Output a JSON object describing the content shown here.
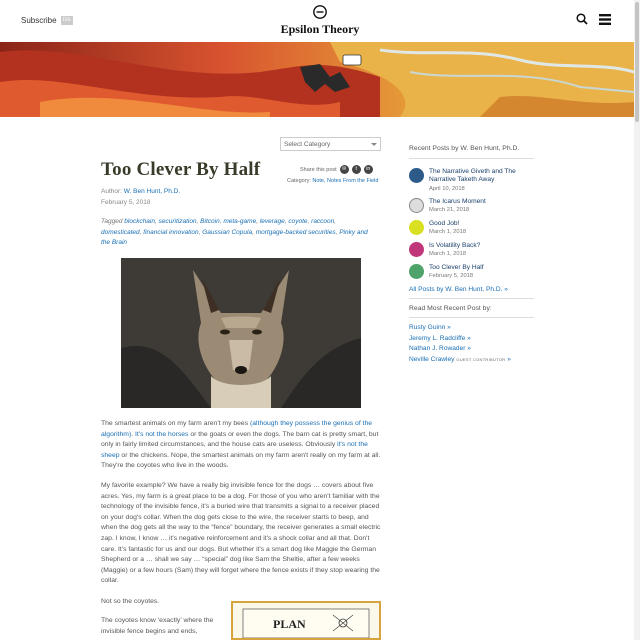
{
  "header": {
    "subscribe_label": "Subscribe",
    "rss_badge": "rss",
    "site_title": "Epsilon Theory",
    "icons": [
      "epsilon-logo-icon",
      "search-icon",
      "hamburger-menu-icon"
    ]
  },
  "category_select": {
    "placeholder": "Select Category"
  },
  "post": {
    "title": "Too Clever By Half",
    "author_prefix": "Author: ",
    "author": "W. Ben Hunt, Ph.D.",
    "date": "February 5, 2018",
    "share_label": "Share this post",
    "category_prefix": "Category: ",
    "category": "Note, Notes From the Field",
    "tagged_prefix": "Tagged ",
    "tags": [
      "blockchain",
      "securitization",
      "Bitcoin",
      "meta-game",
      "leverage",
      "coyote",
      "raccoon",
      "domesticated",
      "financial innovation",
      "Gaussian Copula",
      "mortgage-backed securities",
      "Pinky and the Brain"
    ],
    "p1_a": "The smartest animals on my farm aren't my bees ",
    "p1_link1": "(although they possess the genius of the algorithm)",
    "p1_b": ". ",
    "p1_link2": "It's not the horses",
    "p1_c": " or the goats or even the dogs. The barn cat is pretty smart, but only in fairly limited circumstances, and the house cats are useless. Obviously ",
    "p1_link3": "it's not the sheep",
    "p1_d": " or the chickens. Nope, the smartest animals on my farm aren't really on my farm at all. They're the coyotes who live in the woods.",
    "p2": "My favorite example? We have a really big invisible fence for the dogs … covers about five acres. Yes, my farm is a great place to be a dog. For those of you who aren't familiar with the technology of the invisible fence, it's a buried wire that transmits a signal to a receiver placed on your dog's collar. When the dog gets close to the wire, the receiver starts to beep, and when the dog gets all the way to the “fence” boundary, the receiver generates a small electric zap. I know, I know … it's negative reinforcement and it's a shock collar and all that. Don't care. It's fantastic for us and our dogs. But whether it's a smart dog like Maggie the German Shepherd or a … shall we say … “special” dog like Sam the Sheltie, after a few weeks (Maggie) or a few hours (Sam) they will forget where the fence exists if they stop wearing the collar.",
    "p3": "Not so the coyotes.",
    "p4": "The coyotes know ‘exactly’ where the invisible fence begins and ends,",
    "plan_image_text": "PLAN"
  },
  "sidebar": {
    "recent_heading": "Recent Posts by W. Ben Hunt, Ph.D.",
    "recent_posts": [
      {
        "title": "The Narrative Giveth and The Narrative Taketh Away",
        "date": "April 10, 2018",
        "thumb_color": "#2c5b8a"
      },
      {
        "title": "The Icarus Moment",
        "date": "March 21, 2018",
        "thumb_color": "#888888"
      },
      {
        "title": "Good Job!",
        "date": "March 1, 2018",
        "thumb_color": "#d9e021"
      },
      {
        "title": "Is Volatility Back?",
        "date": "March 1, 2018",
        "thumb_color": "#c0367a"
      },
      {
        "title": "Too Clever By Half",
        "date": "February 5, 2018",
        "thumb_color": "#4ea36a"
      }
    ],
    "all_posts_label": "All Posts by W. Ben Hunt, Ph.D. »",
    "follow_heading": "Read Most Recent Post by:",
    "follow_authors": [
      {
        "name": "Rusty Guinn »"
      },
      {
        "name": "Jeremy L. Radcliffe »"
      },
      {
        "name": "Nathan J. Rowader »"
      },
      {
        "name": "Neville Crawley",
        "badge": "GUEST CONTRIBUTOR",
        "suffix": " »"
      }
    ]
  },
  "colors": {
    "link": "#1a6fb5",
    "title": "#3a3a2a",
    "banner_red": "#c8412b",
    "banner_gold": "#e8a83a"
  }
}
